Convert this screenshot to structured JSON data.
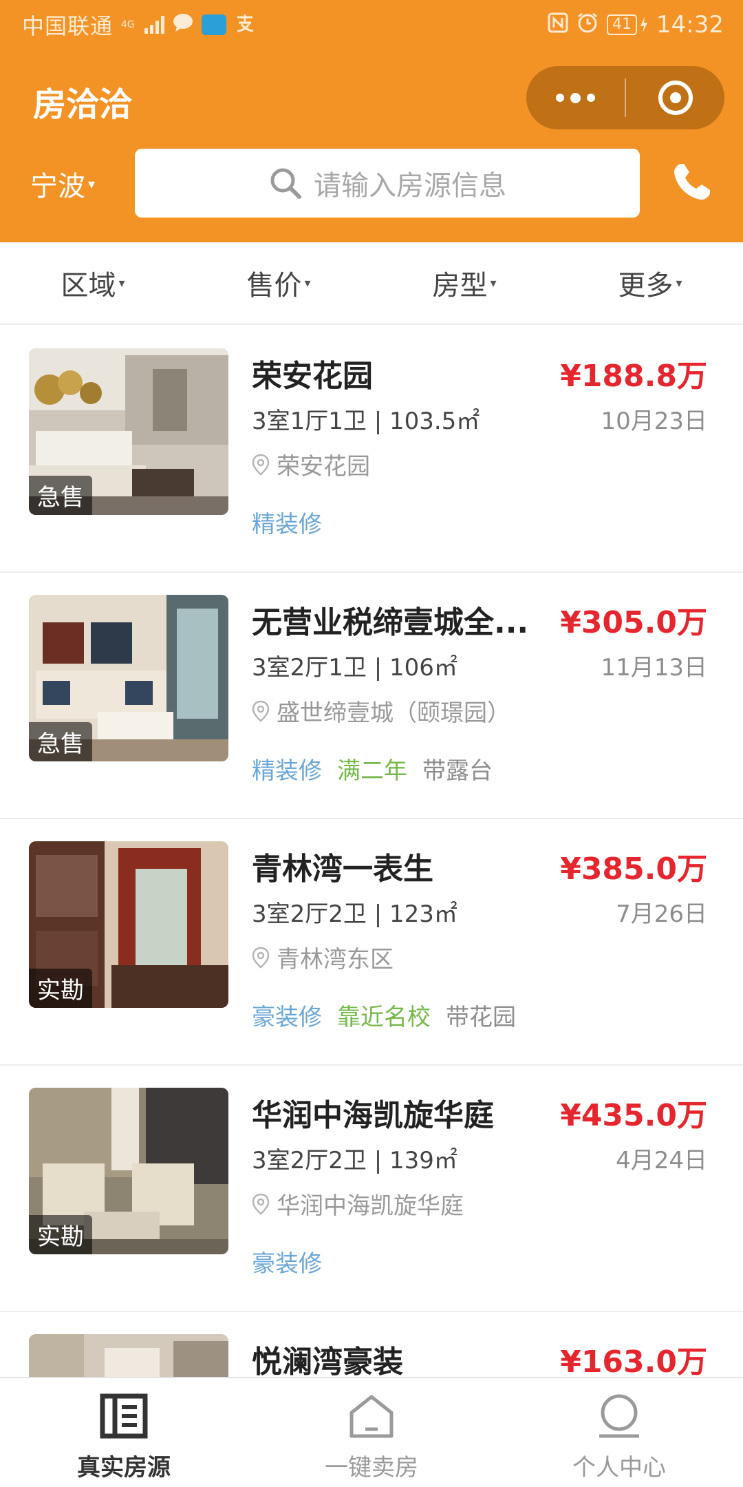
{
  "status_bar": {
    "carrier": "中国联通",
    "network": "4G",
    "clock": "14:32",
    "battery": "41"
  },
  "header": {
    "title": "房洽洽",
    "city": "宁波",
    "search_placeholder": "请输入房源信息",
    "color": "#f39325"
  },
  "filters": [
    {
      "label": "区域"
    },
    {
      "label": "售价"
    },
    {
      "label": "房型"
    },
    {
      "label": "更多"
    }
  ],
  "listings": [
    {
      "title": "荣安花园",
      "price": "¥188.8万",
      "specs": "3室1厅1卫 | 103.5㎡",
      "date": "10月23日",
      "address": "荣安花园",
      "badge": "急售",
      "tags": [
        {
          "text": "精装修",
          "kind": "blue"
        }
      ]
    },
    {
      "title": "无营业税缔壹城全...",
      "price": "¥305.0万",
      "specs": "3室2厅1卫 | 106㎡",
      "date": "11月13日",
      "address": "盛世缔壹城（颐璟园）",
      "badge": "急售",
      "tags": [
        {
          "text": "精装修",
          "kind": "blue"
        },
        {
          "text": "满二年",
          "kind": "green"
        },
        {
          "text": "带露台",
          "kind": "gray"
        }
      ]
    },
    {
      "title": "青林湾一表生",
      "price": "¥385.0万",
      "specs": "3室2厅2卫 | 123㎡",
      "date": "7月26日",
      "address": "青林湾东区",
      "badge": "实勘",
      "tags": [
        {
          "text": "豪装修",
          "kind": "blue"
        },
        {
          "text": "靠近名校",
          "kind": "green"
        },
        {
          "text": "带花园",
          "kind": "gray"
        }
      ]
    },
    {
      "title": "华润中海凯旋华庭",
      "price": "¥435.0万",
      "specs": "3室2厅2卫 | 139㎡",
      "date": "4月24日",
      "address": "华润中海凯旋华庭",
      "badge": "实勘",
      "tags": [
        {
          "text": "豪装修",
          "kind": "blue"
        }
      ]
    },
    {
      "title": "悦澜湾豪装",
      "price": "¥163.0万",
      "specs": "",
      "date": "",
      "address": "",
      "badge": "",
      "tags": []
    }
  ],
  "tabbar": [
    {
      "label": "真实房源",
      "icon": "listing-icon",
      "active": true
    },
    {
      "label": "一键卖房",
      "icon": "house-icon",
      "active": false
    },
    {
      "label": "个人中心",
      "icon": "person-icon",
      "active": false
    }
  ]
}
